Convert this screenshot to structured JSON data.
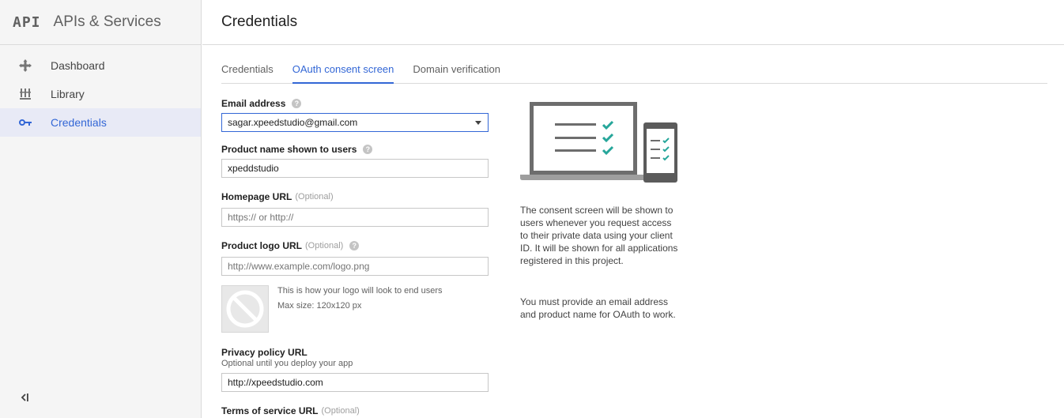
{
  "sidebar": {
    "logo": "API",
    "title": "APIs & Services",
    "items": [
      {
        "label": "Dashboard",
        "icon": "dashboard-icon"
      },
      {
        "label": "Library",
        "icon": "library-icon"
      },
      {
        "label": "Credentials",
        "icon": "key-icon",
        "active": true
      }
    ],
    "collapse_icon": "collapse-sidebar-icon"
  },
  "header": {
    "title": "Credentials"
  },
  "tabs": [
    {
      "label": "Credentials"
    },
    {
      "label": "OAuth consent screen",
      "active": true
    },
    {
      "label": "Domain verification"
    }
  ],
  "form": {
    "email": {
      "label": "Email address",
      "value": "sagar.xpeedstudio@gmail.com"
    },
    "product_name": {
      "label": "Product name shown to users",
      "value": "xpeddstudio"
    },
    "homepage": {
      "label": "Homepage URL",
      "optional": "(Optional)",
      "placeholder": "https:// or http://"
    },
    "logo_url": {
      "label": "Product logo URL",
      "optional": "(Optional)",
      "placeholder": "http://www.example.com/logo.png"
    },
    "logo_hint": "This is how your logo will look to end users",
    "logo_max": "Max size: 120x120 px",
    "privacy": {
      "label": "Privacy policy URL",
      "hint": "Optional until you deploy your app",
      "value": "http://xpeedstudio.com"
    },
    "terms": {
      "label": "Terms of service URL",
      "optional": "(Optional)"
    }
  },
  "info": {
    "paragraph1": "The consent screen will be shown to users whenever you request access to their private data using your client ID. It will be shown for all applications registered in this project.",
    "paragraph2": "You must provide an email address and product name for OAuth to work."
  },
  "colors": {
    "accent": "#3367d6",
    "active_bg": "#e8eaf6",
    "check": "#26a69a"
  }
}
